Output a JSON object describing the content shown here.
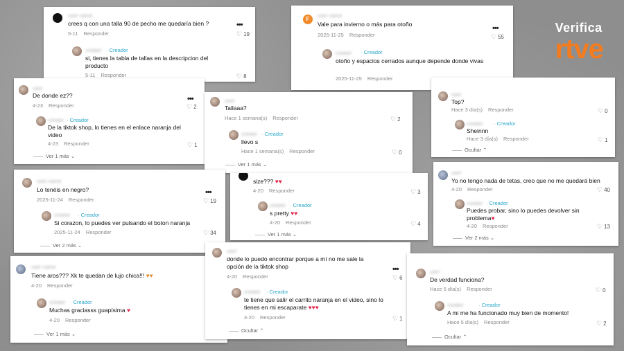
{
  "logo": {
    "verifica": "Verifica",
    "rtve": "rtve"
  },
  "cards": {
    "c1": {
      "comment": "crees q con una talla 90 de pecho me quedaría bien ?",
      "date": "5-11",
      "reply": "Responder",
      "likes": "19",
      "sub": {
        "creator": "· Creador",
        "text": "si, tienes la tabla de tallas en la descripcion del producto",
        "date": "5-11",
        "reply": "Responder",
        "likes": "8"
      }
    },
    "c2": {
      "comment": "Vale para invierno o más para otoño",
      "date": "2025-11-25",
      "reply": "Responder",
      "likes": "55",
      "sub": {
        "creator": "· Creador",
        "text": "otoño y espacios cerrados aunque depende donde vivas",
        "date": "2025-11-25",
        "reply": "Responder"
      }
    },
    "c3": {
      "comment": "De donde ez??",
      "date": "4-23",
      "reply": "Responder",
      "likes": "2",
      "sub": {
        "creator": "· Creador",
        "text": "De la tiktok shop, lo tienes en el enlace naranja del video",
        "date": "4-23",
        "reply": "Responder",
        "likes": "1"
      },
      "more": "Ver 1 más"
    },
    "c4": {
      "comment": "Tallaaa?",
      "date": "Hace 1 semana(s)",
      "reply": "Responder",
      "likes": "2",
      "sub": {
        "creator": "· Creador",
        "text": "llevo s",
        "date": "Hace 1 semana(s)",
        "reply": "Responder",
        "likes": "0"
      },
      "more": "Ver 1 más"
    },
    "c5": {
      "comment": "Top?",
      "date": "Hace 3 día(s)",
      "reply": "Responder",
      "likes": "0",
      "sub": {
        "creator": "· Creador",
        "text": "Sheinnn",
        "date": "Hace 3 día(s)",
        "reply": "Responder",
        "likes": "1"
      },
      "more": "Ocultar"
    },
    "c6": {
      "comment": "Lo tenéis en negro?",
      "date": "2025-11-24",
      "reply": "Responder",
      "likes": "19",
      "sub": {
        "creator": "· Creador",
        "text": "Si corazon, lo puedes ver pulsando el boton naranja",
        "date": "2025-11-24",
        "reply": "Responder",
        "likes": "34"
      },
      "more": "Ver 2 más"
    },
    "c7": {
      "comment": "size???",
      "date": "4-20",
      "reply": "Responder",
      "likes": "3",
      "sub": {
        "creator": "· Creador",
        "text": "s pretty",
        "date": "4-20",
        "reply": "Responder",
        "likes": "4"
      },
      "more": "Ver 1 más"
    },
    "c8": {
      "comment": "Yo no tengo nada de tetas, creo que no me quedará bien",
      "date": "4-20",
      "reply": "Responder",
      "likes": "40",
      "sub": {
        "creator": "· Creador",
        "text": "Puedes probar, sino lo puedes devolver sin problema",
        "date": "4-20",
        "reply": "Responder",
        "likes": "13"
      },
      "more": "Ver 2 más"
    },
    "c9": {
      "comment": "Tiene aros??? Xk te quedan de lujo chica!!!",
      "date": "4-20",
      "reply": "Responder",
      "sub": {
        "creator": "· Creador",
        "text": "Muchas graciasss guapísima",
        "date": "4-20",
        "reply": "Responder"
      },
      "more": "Ver 1 más"
    },
    "c10": {
      "comment": "donde lo puedo encontrar porque a mí no me sale la opción de la tiktok shop",
      "date": "4-20",
      "reply": "Responder",
      "likes": "6",
      "sub": {
        "creator": "· Creador",
        "text": "te tiene que salir el carrito naranja en el video, sino lo tienes en mi escaparate",
        "date": "4-20",
        "reply": "Responder",
        "likes": "1"
      },
      "more": "Ocultar"
    },
    "c11": {
      "comment": "De verdad funciona?",
      "date": "Hace 5 día(s)",
      "reply": "Responder",
      "likes": "0",
      "sub": {
        "creator": "· Creador",
        "text": "A mi me ha funcionado muy bien de momento!",
        "date": "Hace 5 día(s)",
        "reply": "Responder",
        "likes": "2"
      },
      "more": "Ocultar"
    }
  },
  "icons": {
    "heart": "♡",
    "more_options": "•••",
    "chevron": "⌄"
  },
  "colors": {
    "creator": "#2aa7c9",
    "rtve_orange": "#f47c20",
    "red_heart": "#e2264d"
  }
}
